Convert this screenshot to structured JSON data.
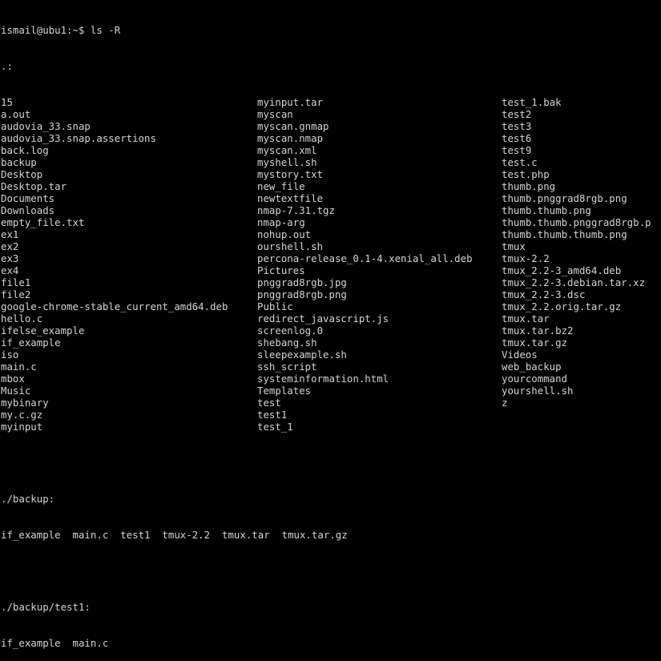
{
  "terminal": {
    "prompt": "ismail@ubu1:~$ ls -R",
    "root_header": ".:",
    "columns": [
      [
        "15",
        "a.out",
        "audovia_33.snap",
        "audovia_33.snap.assertions",
        "back.log",
        "backup",
        "Desktop",
        "Desktop.tar",
        "Documents",
        "Downloads",
        "empty_file.txt",
        "ex1",
        "ex2",
        "ex3",
        "ex4",
        "file1",
        "file2",
        "google-chrome-stable_current_amd64.deb",
        "hello.c",
        "ifelse_example",
        "if_example",
        "iso",
        "main.c",
        "mbox",
        "Music",
        "mybinary",
        "my.c.gz",
        "myinput"
      ],
      [
        "myinput.tar",
        "myscan",
        "myscan.gnmap",
        "myscan.nmap",
        "myscan.xml",
        "myshell.sh",
        "mystory.txt",
        "new_file",
        "newtextfile",
        "nmap-7.31.tgz",
        "nmap-arg",
        "nohup.out",
        "ourshell.sh",
        "percona-release_0.1-4.xenial_all.deb",
        "Pictures",
        "pnggrad8rgb.jpg",
        "pnggrad8rgb.png",
        "Public",
        "redirect_javascript.js",
        "screenlog.0",
        "shebang.sh",
        "sleepexample.sh",
        "ssh_script",
        "systeminformation.html",
        "Templates",
        "test",
        "test1",
        "test_1"
      ],
      [
        "test_1.bak",
        "test2",
        "test3",
        "test6",
        "test9",
        "test.c",
        "test.php",
        "thumb.png",
        "thumb.pnggrad8rgb.png",
        "thumb.thumb.png",
        "thumb.thumb.pnggrad8rgb.p",
        "thumb.thumb.thumb.png",
        "tmux",
        "tmux-2.2",
        "tmux_2.2-3_amd64.deb",
        "tmux_2.2-3.debian.tar.xz",
        "tmux_2.2-3.dsc",
        "tmux_2.2.orig.tar.gz",
        "tmux.tar",
        "tmux.tar.bz2",
        "tmux.tar.gz",
        "Videos",
        "web_backup",
        "yourcommand",
        "yourshell.sh",
        "z"
      ]
    ],
    "backup_header": "./backup:",
    "backup_listing": "if_example  main.c  test1  tmux-2.2  tmux.tar  tmux.tar.gz",
    "backup_test1_header": "./backup/test1:",
    "backup_test1_listing": "if_example  main.c"
  }
}
